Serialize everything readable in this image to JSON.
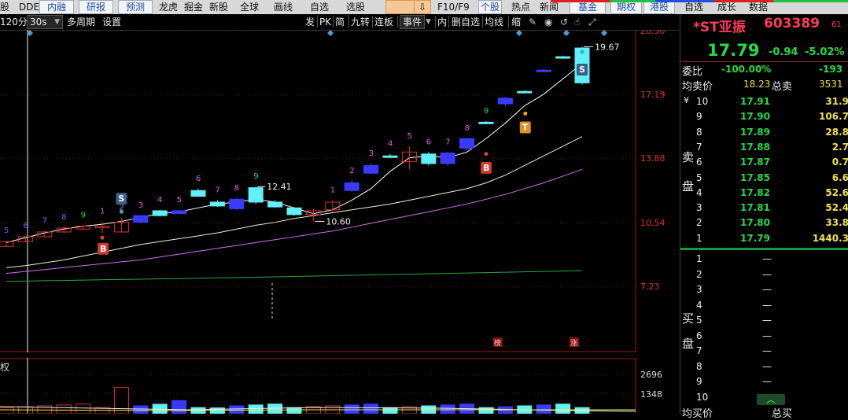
{
  "menubar": {
    "items": [
      "股",
      "DDE",
      "内融",
      "研报",
      "预测",
      "龙虎",
      "掘金",
      "新股",
      "全球",
      "画线",
      "自选",
      "选股",
      "F10/F9",
      "个股",
      "热点",
      "新闻",
      "基金",
      "期权",
      "港股",
      "自选",
      "成长",
      "数据"
    ],
    "colors": {
      "stripe_red": "#e02020",
      "stripe_green": "#20c040",
      "stripe_blue": "#2050e0"
    }
  },
  "toolbar": {
    "period": "120分",
    "interval": "30s",
    "multi_period": "多周期",
    "settings": "设置",
    "right_items": [
      "发",
      "PK",
      "简",
      "九转",
      "连板",
      "事件",
      "内",
      "删自选",
      "均线",
      "缩"
    ]
  },
  "stock": {
    "name": "*ST亚振",
    "code": "603389",
    "suffix": "61",
    "price": "17.79",
    "change": "-0.94",
    "change_pct": "-5.02%"
  },
  "quote": {
    "weibi_label": "委比",
    "weibi_value": "-100.00%",
    "weicha_value": "-193",
    "avg_label": "均卖价",
    "avg_value": "18.23",
    "total_sell_label": "总卖",
    "total_sell_value": "3531",
    "sell_side_label": [
      "卖",
      "盘"
    ],
    "buy_side_label": [
      "买",
      "盘"
    ],
    "sell_rows": [
      {
        "level": "10",
        "price": "17.91",
        "vol": "31.9"
      },
      {
        "level": "9",
        "price": "17.90",
        "vol": "106.7"
      },
      {
        "level": "8",
        "price": "17.89",
        "vol": "28.8"
      },
      {
        "level": "7",
        "price": "17.88",
        "vol": "2.7"
      },
      {
        "level": "6",
        "price": "17.87",
        "vol": "0.7"
      },
      {
        "level": "5",
        "price": "17.85",
        "vol": "6.6"
      },
      {
        "level": "4",
        "price": "17.82",
        "vol": "52.6"
      },
      {
        "level": "3",
        "price": "17.81",
        "vol": "52.4"
      },
      {
        "level": "2",
        "price": "17.80",
        "vol": "33.8"
      },
      {
        "level": "1",
        "price": "17.79",
        "vol": "1440.3"
      }
    ],
    "buy_rows": [
      {
        "level": "1",
        "price": "",
        "vol": "—"
      },
      {
        "level": "2",
        "price": "",
        "vol": "—"
      },
      {
        "level": "3",
        "price": "",
        "vol": "—"
      },
      {
        "level": "4",
        "price": "",
        "vol": "—"
      },
      {
        "level": "5",
        "price": "",
        "vol": "—"
      },
      {
        "level": "6",
        "price": "",
        "vol": "—"
      },
      {
        "level": "7",
        "price": "",
        "vol": "—"
      },
      {
        "level": "8",
        "price": "",
        "vol": "—"
      },
      {
        "level": "9",
        "price": "",
        "vol": "—"
      },
      {
        "level": "10",
        "price": "",
        "vol": "—"
      }
    ],
    "bottom_labels": [
      "均买价",
      "总买"
    ],
    "yen_mark": "¥"
  },
  "chart_data": {
    "type": "candlestick",
    "y_ticks": [
      "20.50",
      "17.19",
      "13.88",
      "10.54",
      "7.23"
    ],
    "y_range": [
      7.23,
      20.5
    ],
    "annotations": {
      "high": "19.67",
      "mid_high": "12.41",
      "mid_low": "10.60",
      "badges": [
        "B",
        "S",
        "B",
        "T",
        "S"
      ],
      "markers": [
        "榜",
        "涨"
      ]
    },
    "candles": [
      {
        "o": 9.3,
        "c": 9.55,
        "h": 9.6,
        "l": 9.3,
        "seq": "5",
        "col": "#7a5cff"
      },
      {
        "o": 9.55,
        "c": 9.8,
        "h": 9.85,
        "l": 9.5,
        "seq": "6",
        "col": "#7a5cff"
      },
      {
        "o": 9.8,
        "c": 10.05,
        "h": 10.1,
        "l": 9.8,
        "seq": "7",
        "col": "#7a5cff"
      },
      {
        "o": 10.05,
        "c": 10.25,
        "h": 10.3,
        "l": 10.0,
        "seq": "8",
        "col": "#7a5cff"
      },
      {
        "o": 10.2,
        "c": 10.35,
        "h": 10.4,
        "l": 10.15,
        "seq": "9",
        "col": "#22dd44"
      },
      {
        "o": 10.35,
        "c": 10.3,
        "h": 10.6,
        "l": 10.0,
        "seq": "1",
        "col": "#e060e0",
        "hollow": true
      },
      {
        "o": 10.05,
        "c": 10.55,
        "h": 10.8,
        "l": 10.05,
        "seq": "2",
        "col": "#e060e0",
        "hollow": true
      },
      {
        "o": 10.9,
        "c": 10.55,
        "h": 10.9,
        "l": 10.5,
        "seq": "3",
        "col": "#e060e0",
        "solid_blue": true
      },
      {
        "o": 10.9,
        "c": 11.15,
        "h": 11.2,
        "l": 10.85,
        "seq": "4",
        "col": "#e060e0",
        "cyan": true
      },
      {
        "o": 11.15,
        "c": 11.0,
        "h": 11.2,
        "l": 11.0,
        "seq": "5",
        "col": "#e060e0",
        "solid_blue": true
      },
      {
        "o": 11.9,
        "c": 12.2,
        "h": 12.3,
        "l": 11.9,
        "seq": "6",
        "col": "#e060e0",
        "cyan": true
      },
      {
        "o": 11.6,
        "c": 11.4,
        "h": 11.7,
        "l": 11.35,
        "seq": "7",
        "col": "#e060e0",
        "cyan": true
      },
      {
        "o": 11.75,
        "c": 11.25,
        "h": 11.8,
        "l": 11.2,
        "seq": "8",
        "col": "#e060e0",
        "solid_blue": true
      },
      {
        "o": 11.6,
        "c": 12.35,
        "h": 12.41,
        "l": 11.5,
        "seq": "9",
        "col": "#22dd44",
        "cyan": true
      },
      {
        "o": 11.6,
        "c": 11.35,
        "h": 11.7,
        "l": 11.3,
        "seq": "",
        "col": "#e060e0",
        "cyan": true
      },
      {
        "o": 11.3,
        "c": 10.95,
        "h": 11.35,
        "l": 10.9,
        "seq": "",
        "col": "#e060e0",
        "cyan": true
      },
      {
        "o": 10.95,
        "c": 11.15,
        "h": 11.25,
        "l": 10.6,
        "seq": "",
        "col": "#e060e0",
        "hollow": true
      },
      {
        "o": 11.2,
        "c": 11.6,
        "h": 11.7,
        "l": 11.1,
        "seq": "1",
        "col": "#e060e0",
        "hollow": true
      },
      {
        "o": 12.2,
        "c": 12.6,
        "h": 12.7,
        "l": 12.15,
        "seq": "2",
        "col": "#e060e0",
        "solid_blue": true
      },
      {
        "o": 13.1,
        "c": 13.5,
        "h": 13.6,
        "l": 13.05,
        "seq": "3",
        "col": "#e060e0",
        "solid_blue": true
      },
      {
        "o": 13.95,
        "c": 14.0,
        "h": 14.1,
        "l": 13.9,
        "seq": "4",
        "col": "#e060e0",
        "cyan": true
      },
      {
        "o": 13.7,
        "c": 14.2,
        "h": 14.5,
        "l": 13.3,
        "seq": "5",
        "col": "#e060e0",
        "hollow": true
      },
      {
        "o": 14.1,
        "c": 13.6,
        "h": 14.2,
        "l": 13.5,
        "seq": "6",
        "col": "#e060e0",
        "cyan": true
      },
      {
        "o": 14.15,
        "c": 13.6,
        "h": 14.2,
        "l": 13.5,
        "seq": "7",
        "col": "#e060e0",
        "solid_blue": true
      },
      {
        "o": 14.4,
        "c": 14.9,
        "h": 14.9,
        "l": 14.3,
        "seq": "8",
        "col": "#e060e0",
        "solid_blue": true
      },
      {
        "o": 15.7,
        "c": 15.75,
        "h": 15.8,
        "l": 15.65,
        "seq": "9",
        "col": "#22dd44",
        "cyan": true
      },
      {
        "o": 16.7,
        "c": 17.0,
        "h": 17.05,
        "l": 16.6,
        "seq": "",
        "col": "#e060e0",
        "solid_blue": true
      },
      {
        "o": 17.3,
        "c": 17.35,
        "h": 17.4,
        "l": 17.25,
        "seq": "",
        "col": "#e060e0",
        "cyan": true
      },
      {
        "o": 18.4,
        "c": 18.45,
        "h": 18.5,
        "l": 18.35,
        "seq": "",
        "col": "#e060e0",
        "solid_blue": true
      },
      {
        "o": 19.1,
        "c": 19.15,
        "h": 19.2,
        "l": 19.05,
        "seq": "",
        "col": "#e060e0",
        "cyan": true
      },
      {
        "o": 17.79,
        "c": 19.6,
        "h": 19.67,
        "l": 17.7,
        "seq": "",
        "col": "#e060e0",
        "cyan": true
      }
    ],
    "ma_white": [
      8.2,
      8.3,
      8.45,
      8.6,
      8.8,
      9.0,
      9.2,
      9.4,
      9.55,
      9.7,
      9.85,
      10.0,
      10.2,
      10.4,
      10.55,
      10.75,
      10.9,
      11.05,
      11.2,
      11.35,
      11.5,
      11.7,
      11.9,
      12.1,
      12.3,
      12.6,
      13.0,
      13.5,
      14.0,
      14.5,
      15.0
    ],
    "ma_magenta": [
      7.9,
      8.0,
      8.1,
      8.2,
      8.3,
      8.4,
      8.5,
      8.6,
      8.75,
      8.9,
      9.05,
      9.2,
      9.35,
      9.5,
      9.65,
      9.8,
      9.95,
      10.1,
      10.3,
      10.5,
      10.7,
      10.9,
      11.1,
      11.3,
      11.5,
      11.75,
      12.0,
      12.3,
      12.6,
      12.95,
      13.3
    ],
    "ma_green": [
      7.48,
      7.5,
      7.52,
      7.53,
      7.55,
      7.57,
      7.58,
      7.6,
      7.62,
      7.63,
      7.65,
      7.67,
      7.68,
      7.7,
      7.72,
      7.74,
      7.76,
      7.78,
      7.8,
      7.82,
      7.84,
      7.86,
      7.88,
      7.9,
      7.92,
      7.94,
      7.96,
      7.98,
      8.0,
      8.02,
      8.05
    ],
    "ma_trail": [
      9.5,
      9.75,
      10.0,
      10.2,
      10.35,
      10.45,
      10.6,
      10.8,
      11.0,
      11.1,
      11.3,
      11.5,
      11.6,
      11.75,
      11.6,
      11.3,
      11.0,
      11.2,
      11.7,
      12.3,
      13.2,
      13.9,
      14.0,
      13.9,
      14.2,
      14.9,
      15.7,
      16.6,
      17.2,
      18.0,
      18.8
    ],
    "sub": {
      "label": "权",
      "y_ticks": [
        "2696",
        "1348"
      ],
      "bars": [
        0,
        0,
        0,
        0,
        0,
        0,
        1800,
        0,
        650,
        900,
        0,
        400,
        0,
        0,
        0,
        0,
        0,
        0,
        0,
        0,
        0,
        0,
        0,
        0,
        0,
        0,
        0,
        0,
        0,
        0,
        0
      ]
    }
  }
}
